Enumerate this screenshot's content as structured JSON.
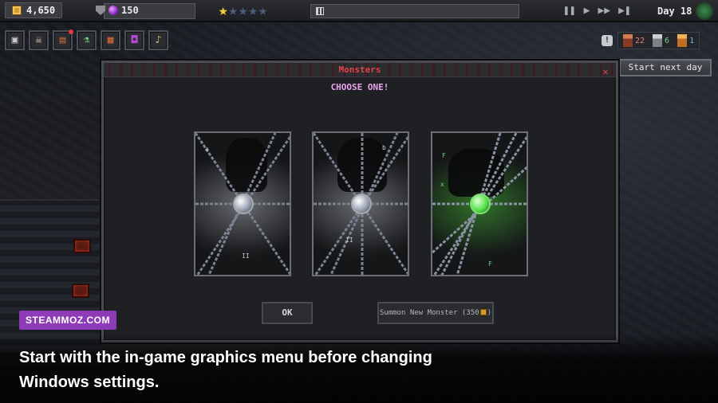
{
  "topbar": {
    "gold": "4,650",
    "gems": "150",
    "stars_filled": 1,
    "stars_total": 5,
    "controls": [
      "pause-icon",
      "play-icon",
      "fast-forward-icon",
      "skip-icon"
    ],
    "day_label": "Day 18"
  },
  "toolbar": {
    "items": [
      "monster-mask-icon",
      "skull-icon",
      "book-icon",
      "potion-icon",
      "chest-icon",
      "cauldron-icon",
      "music-icon"
    ]
  },
  "minions": {
    "counts": [
      "22",
      "6",
      "1"
    ]
  },
  "next_day_label": "Start next day",
  "modal": {
    "title": "Monsters",
    "subtitle": "CHOOSE ONE!",
    "ok_label": "OK",
    "summon_label": "Summon New Monster (350",
    "summon_suffix": ")"
  },
  "cards": [
    {
      "glow": "#cfd3dc",
      "orb": "#9aa3b3",
      "chain": "#7b8292"
    },
    {
      "glow": "#cfd3dc",
      "orb": "#9aa3b3",
      "chain": "#7b8292"
    },
    {
      "glow": "#49c23a",
      "orb": "#57e14a",
      "chain": "#8a93a3"
    }
  ],
  "overlay": {
    "brand": "STEAMMOZ.COM",
    "caption": "Start with the in-game graphics menu before changing Windows settings."
  },
  "colors": {
    "accent_red": "#e0454a",
    "accent_pink": "#e9a3ec",
    "brand_purple": "#8e3bb7"
  }
}
